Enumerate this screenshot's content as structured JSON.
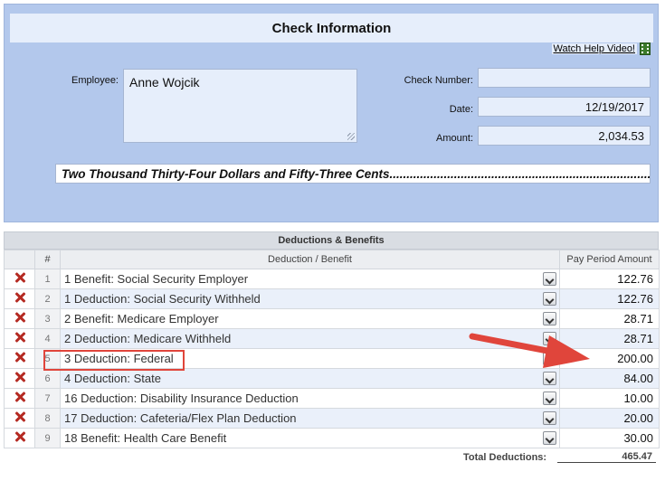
{
  "check": {
    "title": "Check Information",
    "help_link": "Watch Help Video!",
    "employee_label": "Employee:",
    "employee_value": "Anne Wojcik",
    "check_number_label": "Check Number:",
    "check_number_value": "",
    "date_label": "Date:",
    "date_value": "12/19/2017",
    "amount_label": "Amount:",
    "amount_value": "2,034.53",
    "amount_words": "Two Thousand Thirty-Four Dollars and Fifty-Three Cents............................................................................................................................................"
  },
  "deductions": {
    "title": "Deductions & Benefits",
    "col_num": "#",
    "col_desc": "Deduction / Benefit",
    "col_amount": "Pay Period Amount",
    "rows": [
      {
        "num": "1",
        "desc": "1 Benefit: Social Security Employer",
        "amount": "122.76"
      },
      {
        "num": "2",
        "desc": "1 Deduction: Social Security Withheld",
        "amount": "122.76"
      },
      {
        "num": "3",
        "desc": "2 Benefit: Medicare Employer",
        "amount": "28.71"
      },
      {
        "num": "4",
        "desc": "2 Deduction: Medicare Withheld",
        "amount": "28.71"
      },
      {
        "num": "5",
        "desc": "3 Deduction: Federal",
        "amount": "200.00"
      },
      {
        "num": "6",
        "desc": "4 Deduction: State",
        "amount": "84.00"
      },
      {
        "num": "7",
        "desc": "16 Deduction: Disability Insurance Deduction",
        "amount": "10.00"
      },
      {
        "num": "8",
        "desc": "17 Deduction: Cafeteria/Flex Plan Deduction",
        "amount": "20.00"
      },
      {
        "num": "9",
        "desc": "18 Benefit: Health Care Benefit",
        "amount": "30.00"
      }
    ],
    "total_label": "Total Deductions:",
    "total_value": "465.47"
  },
  "icons": {
    "delete": "delete-x-icon",
    "dropdown": "chevron-down-icon",
    "video": "film-icon"
  },
  "colors": {
    "panel_bg": "#b3c8ec",
    "delete_icon": "#b52a22",
    "annotation": "#e0453b"
  }
}
